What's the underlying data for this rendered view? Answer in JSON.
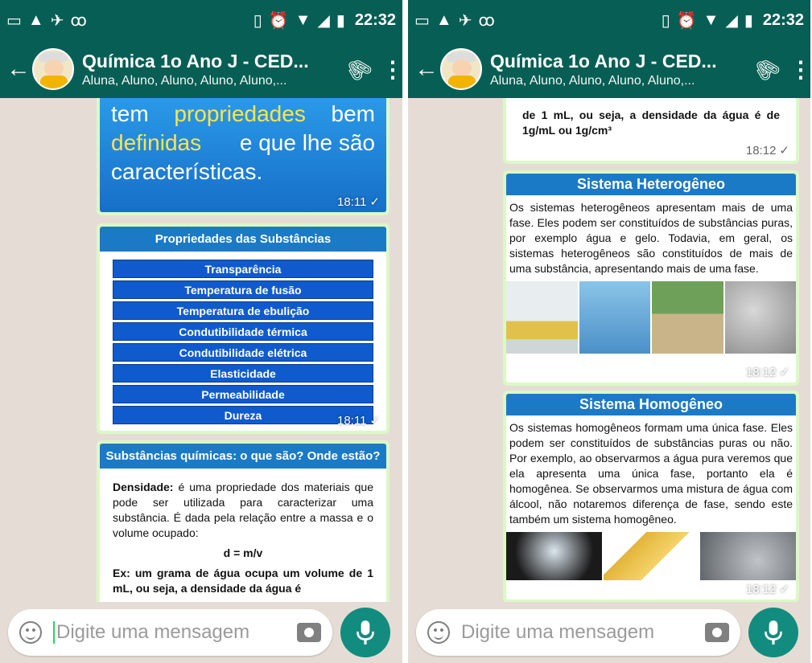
{
  "status_bar": {
    "time": "22:32"
  },
  "chat": {
    "title": "Química 1o Ano J - CED...",
    "subtitle": "Aluna, Aluno, Aluno, Aluno, Aluno,..."
  },
  "input": {
    "placeholder": "Digite uma mensagem"
  },
  "left": {
    "msg1": {
      "line1a": "tem ",
      "line1b": "propriedades",
      "line1c": " bem",
      "line2a": "definidas",
      "line2b": " e que lhe são",
      "line3": "características.",
      "time": "18:11"
    },
    "msg2": {
      "title": "Propriedades das Substâncias",
      "items": [
        "Transparência",
        "Temperatura de fusão",
        "Temperatura de ebulição",
        "Condutibilidade térmica",
        "Condutibilidade elétrica",
        "Elasticidade",
        "Permeabilidade",
        "Dureza"
      ],
      "time": "18:11"
    },
    "msg3": {
      "title": "Substâncias químicas: o que são? Onde estão?",
      "term": "Densidade:",
      "text": " é uma propriedade dos materiais que pode ser utilizada para caracterizar uma substância. É dada pela relação entre a massa e o volume ocupado:",
      "formula": "d = m/v",
      "example": "Ex: um grama de água ocupa um volume de 1 mL, ou seja, a densidade da água é"
    }
  },
  "right": {
    "msg1": {
      "text": "de 1 mL, ou seja, a densidade da água é de 1g/mL ou 1g/cm³",
      "time": "18:12"
    },
    "msg2": {
      "title": "Sistema Heterogêneo",
      "text": "Os sistemas heterogêneos apresentam mais de uma fase. Eles podem ser constituídos de substâncias puras, por exemplo água e gelo. Todavia, em geral, os sistemas heterogêneos são constituídos de mais de uma substância, apresentando mais de uma fase.",
      "time": "18:12"
    },
    "msg3": {
      "title": "Sistema Homogêneo",
      "text": "Os sistemas homogêneos formam uma única fase. Eles podem ser constituídos de substâncias puras ou não. Por exemplo, ao observarmos a água pura veremos que ela apresenta uma única fase, portanto ela é homogênea. Se observarmos uma mistura de água com álcool, não notaremos diferença de fase, sendo este também um sistema homogêneo.",
      "time": "18:12"
    }
  },
  "colors": {
    "header": "#075e54",
    "bubble": "#dcf8c6",
    "mic": "#128c7e",
    "wallpaper": "#e5ddd5"
  }
}
